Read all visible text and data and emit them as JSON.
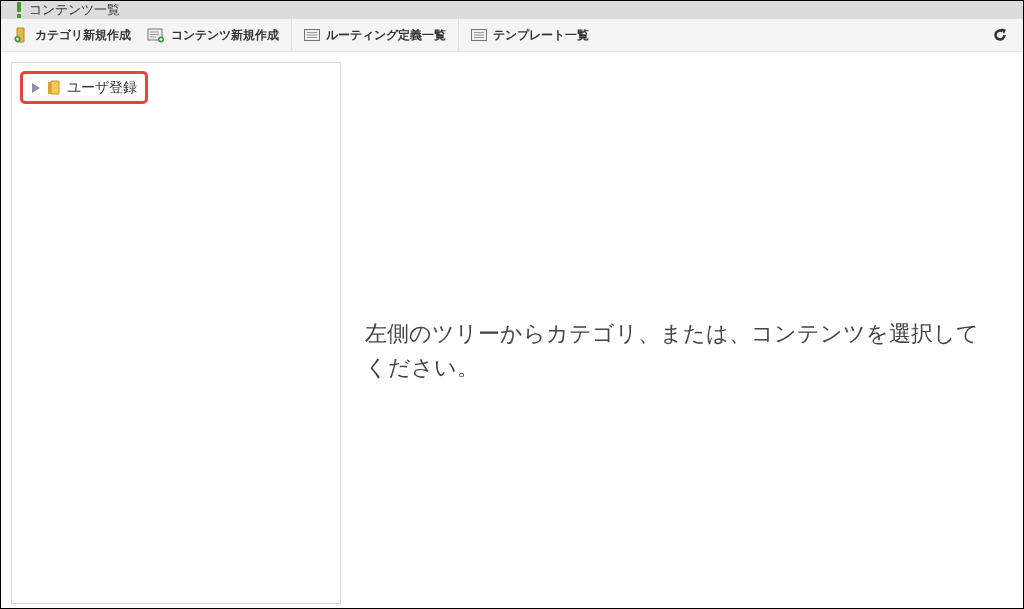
{
  "window": {
    "title": "コンテンツ一覧"
  },
  "toolbar": [
    {
      "label": "カテゴリ新規作成",
      "kind": "folder-add",
      "separated": false
    },
    {
      "label": "コンテンツ新規作成",
      "kind": "doc-add",
      "separated": false
    },
    {
      "label": "ルーティング定義一覧",
      "kind": "list",
      "separated": true
    },
    {
      "label": "テンプレート一覧",
      "kind": "list",
      "separated": true
    }
  ],
  "tree": [
    {
      "label": "ユーザ登録",
      "expanded": false,
      "highlighted": true
    }
  ],
  "message": "左側のツリーからカテゴリ、または、コンテンツを選択してください。"
}
